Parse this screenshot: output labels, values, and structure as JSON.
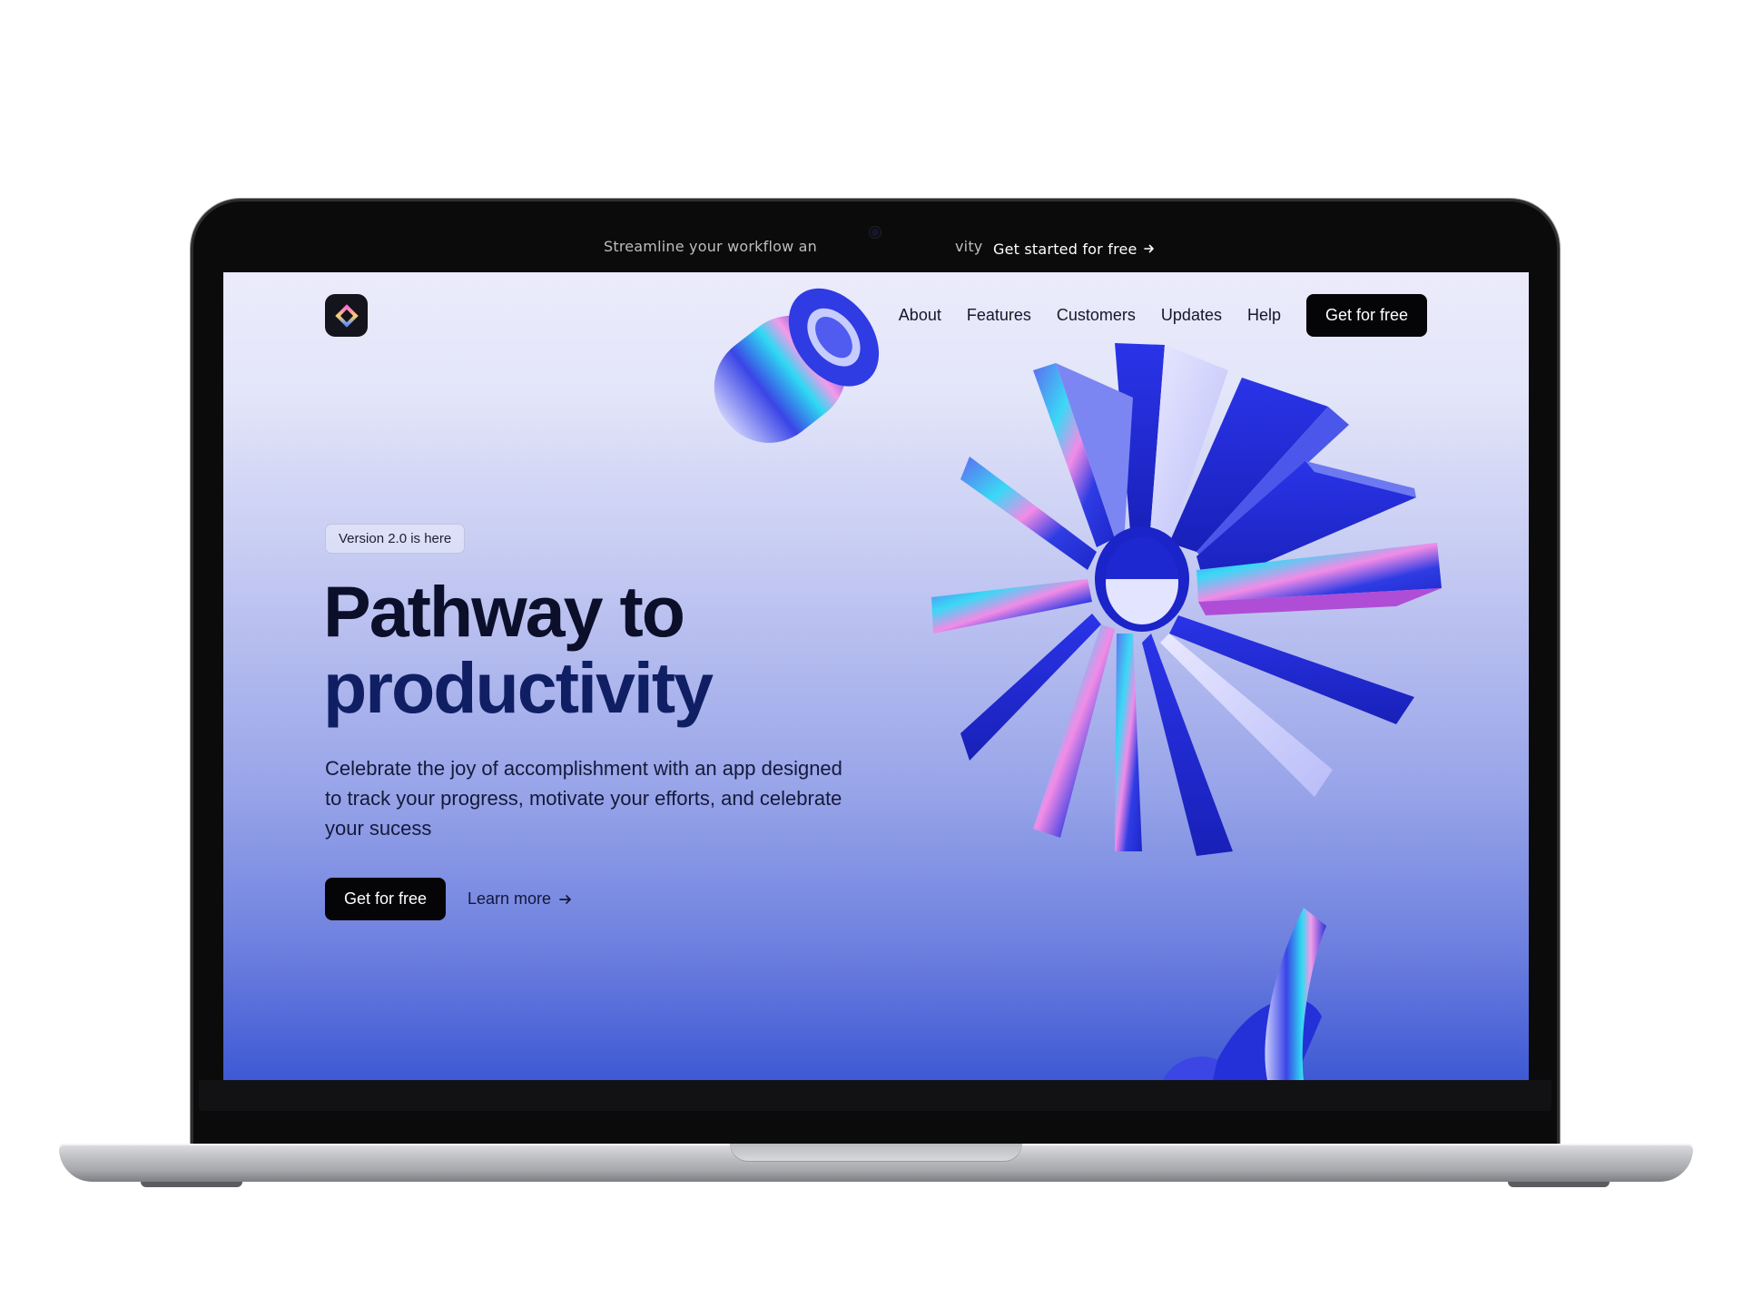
{
  "announcement": {
    "text_left": "Streamline your workflow an",
    "text_right": "vity",
    "cta": "Get started for free",
    "cta_icon": "arrow-right-icon"
  },
  "header": {
    "logo_icon": "diamond-logo-icon",
    "nav": [
      "About",
      "Features",
      "Customers",
      "Updates",
      "Help"
    ],
    "cta": "Get for free"
  },
  "hero": {
    "badge": "Version 2.0 is here",
    "title_line1": "Pathway to",
    "title_line2": "productivity",
    "description": "Celebrate the joy of accomplishment with an app designed to track your progress, motivate your efforts, and celebrate your sucess",
    "primary_cta": "Get for free",
    "secondary_cta": "Learn more",
    "secondary_icon": "arrow-right-icon"
  },
  "colors": {
    "accent": "#2b3fe0",
    "dark": "#050508",
    "gradient_top": "#ebebfb",
    "gradient_bottom": "#3e59d4"
  }
}
